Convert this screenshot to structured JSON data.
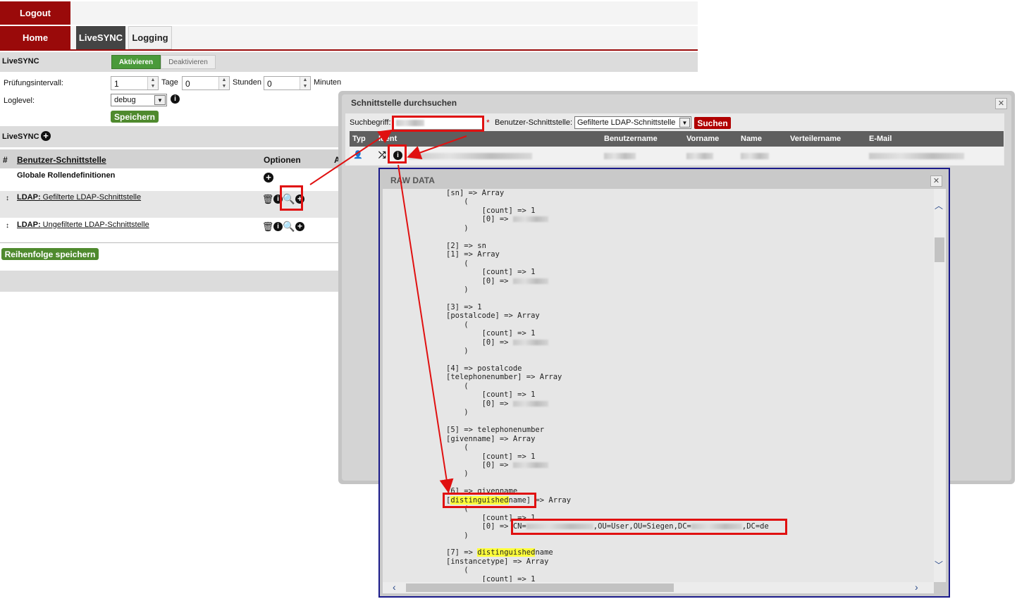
{
  "nav": {
    "logout": "Logout",
    "home": "Home",
    "tabs": [
      "LiveSYNC",
      "Logging"
    ]
  },
  "livesync": {
    "title": "LiveSYNC",
    "activate": "Aktivieren",
    "deactivate": "Deaktivieren",
    "interval_label": "Prüfungsintervall:",
    "days_value": "1",
    "days_unit": "Tage",
    "hours_value": "0",
    "hours_unit": "Stunden",
    "minutes_value": "0",
    "minutes_unit": "Minuten",
    "loglevel_label": "Loglevel:",
    "loglevel_value": "debug",
    "save": "Speichern",
    "section_title": "LiveSYNC",
    "table": {
      "col_hash": "#",
      "col_interface": "Benutzer-Schnittstelle",
      "col_options": "Optionen",
      "col_a": "A",
      "global_roles": "Globale Rollendefinitionen",
      "rows": [
        {
          "prefix": "LDAP:",
          "name": "Gefilterte LDAP-Schnittstelle"
        },
        {
          "prefix": "LDAP:",
          "name": "Ungefilterte LDAP-Schnittstelle"
        }
      ]
    },
    "save_order": "Reihenfolge speichern"
  },
  "search_dialog": {
    "title": "Schnittstelle durchsuchen",
    "search_label": "Suchbegriff:",
    "required_mark": "*",
    "interface_label": "Benutzer-Schnittstelle:",
    "interface_value": "Gefilterte LDAP-Schnittstelle",
    "search_button": "Suchen",
    "columns": [
      "Typ",
      "Ident",
      "Benutzername",
      "Vorname",
      "Name",
      "Verteilername",
      "E-Mail"
    ]
  },
  "raw_dialog": {
    "title": "RAW DATA",
    "lines": [
      {
        "t": "[sn] => Array"
      },
      {
        "t": "    ("
      },
      {
        "t": "        [count] => 1"
      },
      {
        "t": "        [0] => ",
        "blur": true
      },
      {
        "t": "    )"
      },
      {
        "t": ""
      },
      {
        "t": "[2] => sn"
      },
      {
        "t": "[1] => Array"
      },
      {
        "t": "    ("
      },
      {
        "t": "        [count] => 1"
      },
      {
        "t": "        [0] => ",
        "blur": true
      },
      {
        "t": "    )"
      },
      {
        "t": ""
      },
      {
        "t": "[3] => 1"
      },
      {
        "t": "[postalcode] => Array"
      },
      {
        "t": "    ("
      },
      {
        "t": "        [count] => 1"
      },
      {
        "t": "        [0] => ",
        "blur": true
      },
      {
        "t": "    )"
      },
      {
        "t": ""
      },
      {
        "t": "[4] => postalcode"
      },
      {
        "t": "[telephonenumber] => Array"
      },
      {
        "t": "    ("
      },
      {
        "t": "        [count] => 1"
      },
      {
        "t": "        [0] => ",
        "blur": true
      },
      {
        "t": "    )"
      },
      {
        "t": ""
      },
      {
        "t": "[5] => telephonenumber"
      },
      {
        "t": "[givenname] => Array"
      },
      {
        "t": "    ("
      },
      {
        "t": "        [count] => 1"
      },
      {
        "t": "        [0] => ",
        "blur": true
      },
      {
        "t": "    )"
      },
      {
        "t": ""
      },
      {
        "t": "[6] => givenname"
      },
      {
        "t": "[",
        "hl": "distinguished",
        "rest": "name] => Array"
      },
      {
        "t": "    ("
      },
      {
        "t": "        [count] => 1"
      },
      {
        "t": "        [0] => CN=",
        "blur": true,
        "after": ",OU=User,OU=Siegen,DC=",
        "blur2": true,
        "after2": ",DC=de"
      },
      {
        "t": "    )"
      },
      {
        "t": ""
      },
      {
        "t": "[7] => ",
        "hl": "distinguished",
        "rest": "name"
      },
      {
        "t": "[instancetype] => Array"
      },
      {
        "t": "    ("
      },
      {
        "t": "        [count] => 1"
      }
    ]
  }
}
